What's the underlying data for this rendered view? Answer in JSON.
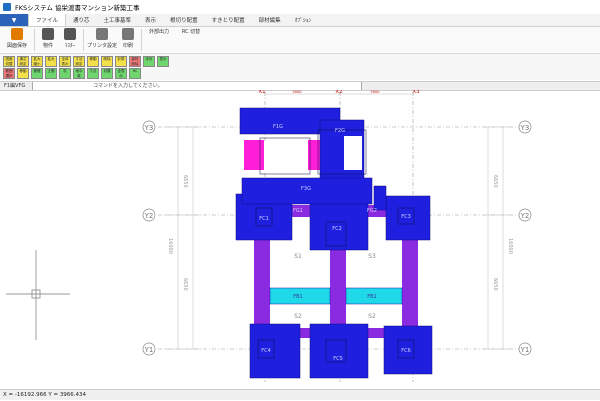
{
  "title": "FKSシステム 協栄渡書マンション新築工事",
  "menu": {
    "drop_arrow": "▼",
    "tabs": [
      "ファイル",
      "通り芯",
      "土工事基準",
      "表示",
      "根切り配置",
      "すきとり配置",
      "部材編集",
      "ｵﾌﾟｼｮﾝ"
    ]
  },
  "ribbon": {
    "buttons": [
      {
        "label": "図面保存",
        "icon": "save-icon",
        "color": "#e07b00"
      },
      {
        "label": "物件",
        "icon": "property-icon",
        "color": "#555555"
      },
      {
        "label": "ﾏｽﾀｰ",
        "icon": "master-icon",
        "color": "#555555"
      },
      {
        "label": "プリンタ設定",
        "icon": "printer-settings-icon",
        "color": "#666666"
      },
      {
        "label": "印刷",
        "icon": "printer-icon",
        "color": "#666666"
      }
    ],
    "text_buttons": [
      "外部出力",
      "RC 切替"
    ]
  },
  "toolbar2": [
    {
      "label": "図面 切替",
      "color": "#f4e04a"
    },
    {
      "label": "通芯 設定",
      "color": "#f4e04a"
    },
    {
      "label": "拡大 縮小",
      "color": "#f4e04a"
    },
    {
      "label": "拡大",
      "color": "#f4e04a"
    },
    {
      "label": "全体 表示",
      "color": "#f4e04a"
    },
    {
      "label": "寸法 設定",
      "color": "#f4e04a"
    },
    {
      "label": "移動",
      "color": "#f4e04a"
    },
    {
      "label": "削除",
      "color": "#f4e04a"
    },
    {
      "label": "計算",
      "color": "#f4e04a"
    },
    {
      "label": "部材 削除",
      "color": "#f07878"
    },
    {
      "label": "手計",
      "color": "#6fd66f"
    },
    {
      "label": "表示",
      "color": "#6fd66f"
    },
    {
      "label": "範囲 選択",
      "color": "#f07878"
    },
    {
      "label": "移動",
      "color": "#f4e04a"
    },
    {
      "label": "基礎",
      "color": "#6fd66f"
    },
    {
      "label": "土間",
      "color": "#6fd66f"
    },
    {
      "label": "杭",
      "color": "#6fd66f"
    },
    {
      "label": "地中梁",
      "color": "#6fd66f"
    },
    {
      "label": "寸法",
      "color": "#6fd66f"
    },
    {
      "label": "切替",
      "color": "#6fd66f"
    },
    {
      "label": "全表示",
      "color": "#6fd66f"
    },
    {
      "label": "RC",
      "color": "#6fd66f"
    }
  ],
  "command": {
    "label": "F1編VFG",
    "placeholder": "コマンドを入力してください。"
  },
  "drawing": {
    "x_axes": [
      "X1",
      "X2",
      "X3"
    ],
    "y_axes": [
      "Y3",
      "Y2",
      "Y1"
    ],
    "dims_top": [
      "5000",
      "5000"
    ],
    "dims_left": [
      "6650",
      "6650",
      "16000"
    ],
    "dims_right": [
      "6650",
      "6650",
      "16000"
    ],
    "labels": {
      "fg1": "F1G",
      "fg2": "F2G",
      "fg3": "F3G",
      "fg4": "FG1",
      "fg5": "FG2",
      "fb": "FB1",
      "fb2": "FB1",
      "s1": "S1",
      "s2": "S2",
      "s3": "S3",
      "s4": "S2",
      "fc1": "FC1",
      "fc2": "FC2",
      "fc3": "FC3",
      "fc4": "FC4",
      "fc5": "FC5",
      "fc6": "FC6"
    }
  },
  "colors": {
    "blue": "#1f1fe0",
    "purple": "#8a2be2",
    "magenta": "#ff1fd8",
    "cyan": "#1fd8e8",
    "axis": "#888888"
  },
  "status": "X = -16192.966  Y = 3966.434"
}
